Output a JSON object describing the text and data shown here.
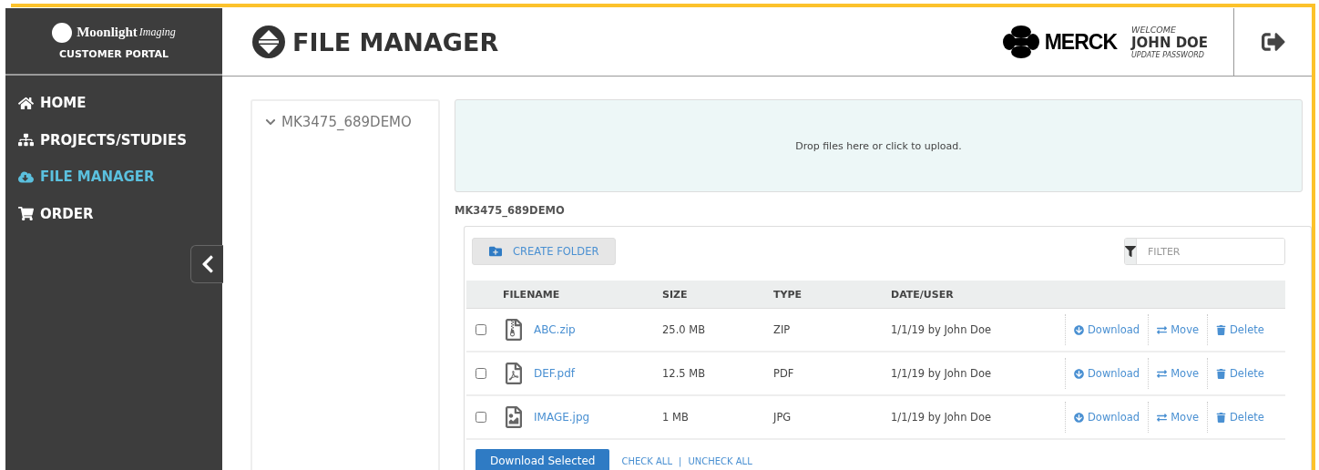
{
  "sidebar": {
    "logo": {
      "name": "Moonlight",
      "tagline": "Imaging"
    },
    "portal": "CUSTOMER PORTAL",
    "nav": [
      {
        "label": "HOME",
        "selected": false
      },
      {
        "label": "PROJECTS/STUDIES",
        "selected": false
      },
      {
        "label": "FILE MANAGER",
        "selected": true
      },
      {
        "label": "ORDER",
        "selected": false
      }
    ]
  },
  "header": {
    "title": "FILE MANAGER",
    "brand": "MERCK",
    "welcome": "WELCOME",
    "user": "JOHN DOE",
    "update_password": "UPDATE PASSWORD"
  },
  "tree": [
    {
      "label": "MK3475_689DEMO",
      "expanded": true
    }
  ],
  "dropzone": "Drop files here or click to upload.",
  "folder_title": "MK3475_689DEMO",
  "create_folder": "CREATE FOLDER",
  "filter": {
    "placeholder": "FILTER"
  },
  "table": {
    "columns": [
      "FILENAME",
      "SIZE",
      "TYPE",
      "DATE/USER"
    ],
    "rows": [
      {
        "kind": "zip",
        "checked": false,
        "name": "ABC.zip",
        "size": "25.0 MB",
        "type": "ZIP",
        "date": "1/1/19 by John Doe",
        "actions": [
          "Download",
          "Move",
          "Delete"
        ]
      },
      {
        "kind": "pdf",
        "checked": false,
        "name": "DEF.pdf",
        "size": "12.5 MB",
        "type": "PDF",
        "date": "1/1/19 by John Doe",
        "actions": [
          "Download",
          "Move",
          "Delete"
        ]
      },
      {
        "kind": "image",
        "checked": false,
        "name": "IMAGE.jpg",
        "size": "1 MB",
        "type": "JPG",
        "date": "1/1/19 by John Doe",
        "actions": [
          "Download",
          "Move",
          "Delete"
        ]
      }
    ]
  },
  "footer": {
    "download_selected": "Download Selected",
    "check_all": "CHECK ALL",
    "separator": "|",
    "uncheck_all": "UNCHECK ALL"
  }
}
